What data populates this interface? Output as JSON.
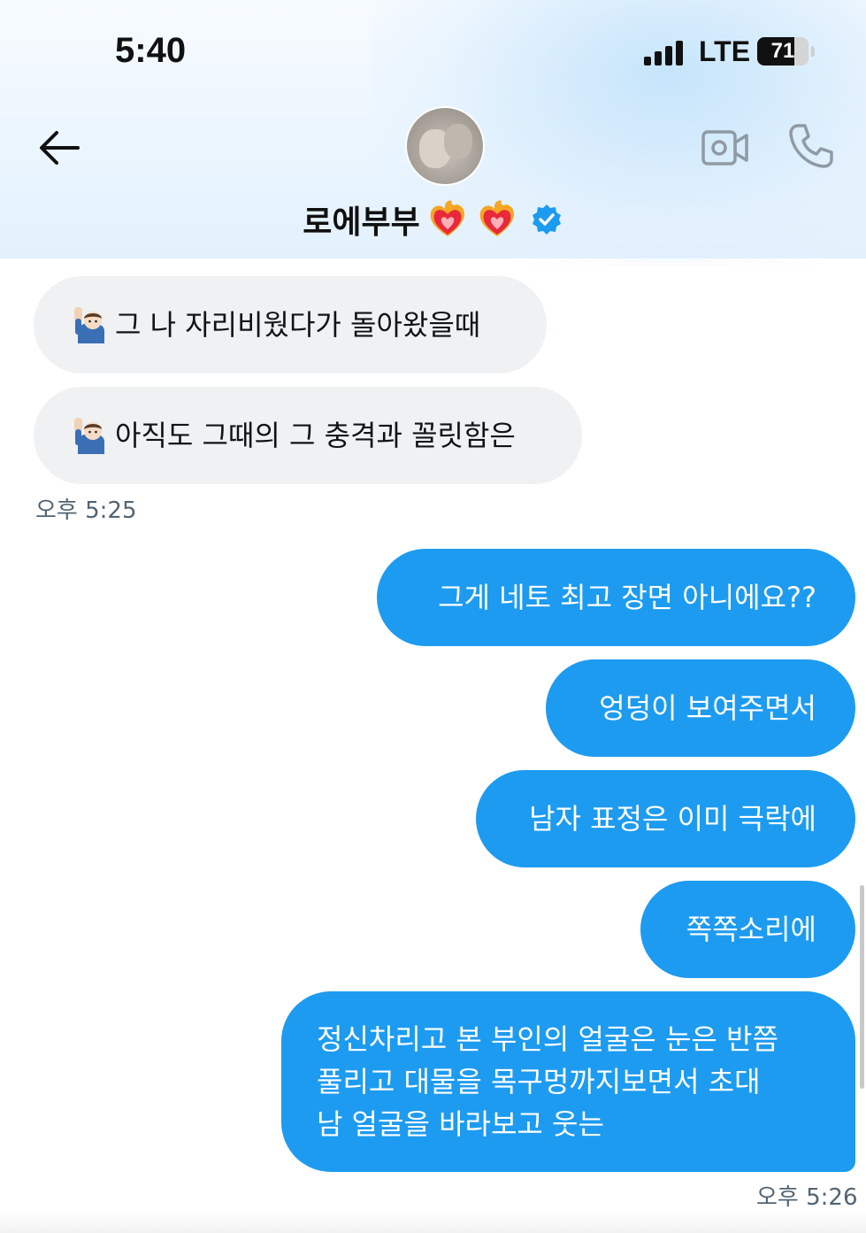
{
  "status_bar": {
    "time": "5:40",
    "network": "LTE",
    "battery": "71"
  },
  "header": {
    "contact_name": "로에부부",
    "icons": [
      "back-arrow-icon",
      "avatar",
      "heart-on-fire-emoji",
      "verified-badge-icon",
      "video-call-icon",
      "phone-call-icon"
    ]
  },
  "colors": {
    "accent": "#1d9bf0",
    "incoming_bubble": "#eff1f3",
    "timestamp": "#536471"
  },
  "messages": [
    {
      "direction": "incoming",
      "text": "그 나 자리비웠다가 돌아왔을때",
      "emoji": "person-raising-hand-emoji"
    },
    {
      "direction": "incoming",
      "text": "아직도 그때의 그 충격과 꼴릿함은",
      "emoji": "person-raising-hand-emoji"
    },
    {
      "direction": "timestamp",
      "text": "오후 5:25"
    },
    {
      "direction": "outgoing",
      "text": "그게 네토 최고 장면 아니에요??"
    },
    {
      "direction": "outgoing",
      "text": "엉덩이 보여주면서"
    },
    {
      "direction": "outgoing",
      "text": "남자 표정은 이미 극락에"
    },
    {
      "direction": "outgoing",
      "text": "쪽쪽소리에"
    },
    {
      "direction": "outgoing",
      "lines": [
        "정신차리고 본 부인의 얼굴은 눈은 반쯤",
        "풀리고 대물을 목구멍까지보면서 초대",
        "남 얼굴을 바라보고 웃는"
      ]
    },
    {
      "direction": "timestamp",
      "text": "오후 5:26"
    }
  ]
}
